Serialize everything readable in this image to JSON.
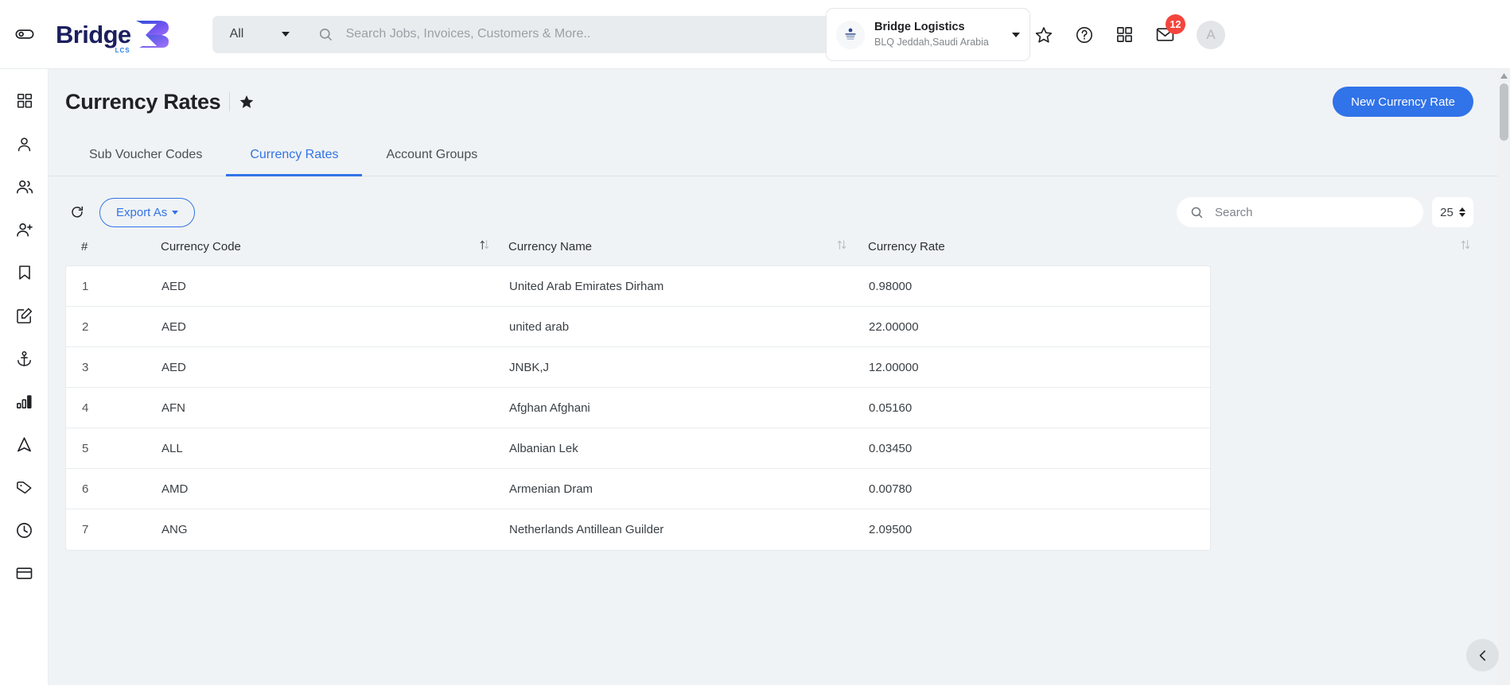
{
  "topbar": {
    "toggle_icon": "sidebar-toggle-icon",
    "logo_text": "Bridge",
    "logo_sub": "LCS",
    "scope_select": {
      "value": "All",
      "icon": "chevron-down-icon"
    },
    "search": {
      "value": "",
      "placeholder": "Search Jobs, Invoices, Customers & More..",
      "icon": "search-icon"
    },
    "org": {
      "name": "Bridge Logistics",
      "location": "BLQ Jeddah,Saudi Arabia",
      "avatar_icon": "org-logo-icon",
      "caret_icon": "chevron-down-icon"
    },
    "icons": [
      {
        "name": "favorites-star-icon",
        "glyph": "star"
      },
      {
        "name": "help-icon",
        "glyph": "question"
      },
      {
        "name": "apps-grid-icon",
        "glyph": "grid"
      },
      {
        "name": "messages-envelope-icon",
        "glyph": "envelope",
        "badge": "12"
      }
    ],
    "avatar_letter": "A"
  },
  "sidebar": {
    "items": [
      {
        "name": "sidebar-item-dashboard",
        "icon": "grid-icon"
      },
      {
        "name": "sidebar-item-profile",
        "icon": "user-icon"
      },
      {
        "name": "sidebar-item-customers",
        "icon": "users-icon"
      },
      {
        "name": "sidebar-item-add-user",
        "icon": "user-plus-icon"
      },
      {
        "name": "sidebar-item-bookmarks",
        "icon": "bookmark-icon"
      },
      {
        "name": "sidebar-item-edit",
        "icon": "edit-square-icon"
      },
      {
        "name": "sidebar-item-shipping",
        "icon": "anchor-icon"
      },
      {
        "name": "sidebar-item-reports",
        "icon": "bar-chart-icon"
      },
      {
        "name": "sidebar-item-navigation",
        "icon": "navigation-arrow-icon"
      },
      {
        "name": "sidebar-item-tags",
        "icon": "tag-icon"
      },
      {
        "name": "sidebar-item-history",
        "icon": "clock-icon"
      },
      {
        "name": "sidebar-item-cards",
        "icon": "card-icon"
      }
    ]
  },
  "page": {
    "title": "Currency Rates",
    "star_icon": "favorite-star-filled-icon",
    "new_button": "New Currency Rate"
  },
  "tabs": [
    {
      "label": "Sub Voucher Codes",
      "active": false,
      "name": "tab-sub-voucher-codes"
    },
    {
      "label": "Currency Rates",
      "active": true,
      "name": "tab-currency-rates"
    },
    {
      "label": "Account Groups",
      "active": false,
      "name": "tab-account-groups"
    }
  ],
  "toolbar": {
    "refresh_icon": "refresh-icon",
    "export_label": "Export As",
    "search": {
      "value": "",
      "placeholder": "Search",
      "icon": "search-icon"
    },
    "page_size": "25"
  },
  "table": {
    "columns": [
      {
        "label": "#",
        "sortable": false,
        "name": "col-index"
      },
      {
        "label": "Currency Code",
        "sortable": true,
        "name": "col-currency-code"
      },
      {
        "label": "Currency Name",
        "sortable": true,
        "name": "col-currency-name"
      },
      {
        "label": "Currency Rate",
        "sortable": true,
        "name": "col-currency-rate"
      }
    ],
    "rows": [
      {
        "index": "1",
        "code": "AED",
        "name": "United Arab Emirates Dirham",
        "rate": "0.98000"
      },
      {
        "index": "2",
        "code": "AED",
        "name": "united arab",
        "rate": "22.00000"
      },
      {
        "index": "3",
        "code": "AED",
        "name": "JNBK,J",
        "rate": "12.00000"
      },
      {
        "index": "4",
        "code": "AFN",
        "name": "Afghan Afghani",
        "rate": "0.05160"
      },
      {
        "index": "5",
        "code": "ALL",
        "name": "Albanian Lek",
        "rate": "0.03450"
      },
      {
        "index": "6",
        "code": "AMD",
        "name": "Armenian Dram",
        "rate": "0.00780"
      },
      {
        "index": "7",
        "code": "ANG",
        "name": "Netherlands Antillean Guilder",
        "rate": "2.09500"
      }
    ]
  },
  "colors": {
    "accent": "#3173e8",
    "badge": "#f4453c",
    "page_bg": "#f0f3f5",
    "logo_navy": "#1b1f5e"
  },
  "collapse_fab_icon": "chevron-left-icon"
}
